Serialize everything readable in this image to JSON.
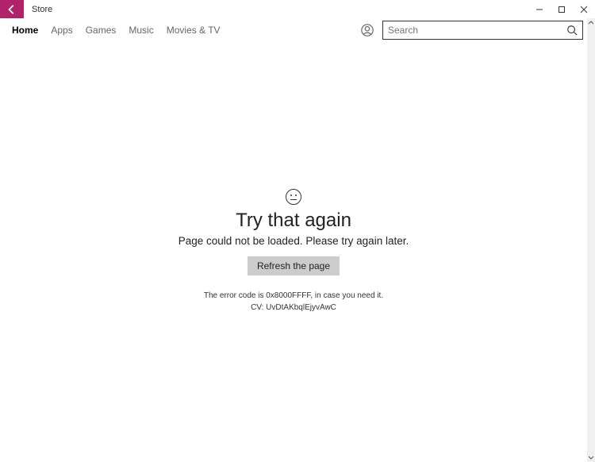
{
  "window": {
    "title": "Store"
  },
  "nav": {
    "items": [
      "Home",
      "Apps",
      "Games",
      "Music",
      "Movies & TV"
    ],
    "active_index": 0
  },
  "search": {
    "placeholder": "Search",
    "value": ""
  },
  "error": {
    "title": "Try that again",
    "message": "Page could not be loaded. Please try again later.",
    "refresh_label": "Refresh the page",
    "code_line": "The error code is 0x8000FFFF, in case you need it.",
    "cv_line": "CV: UvDtAKbqlEjyvAwC"
  }
}
